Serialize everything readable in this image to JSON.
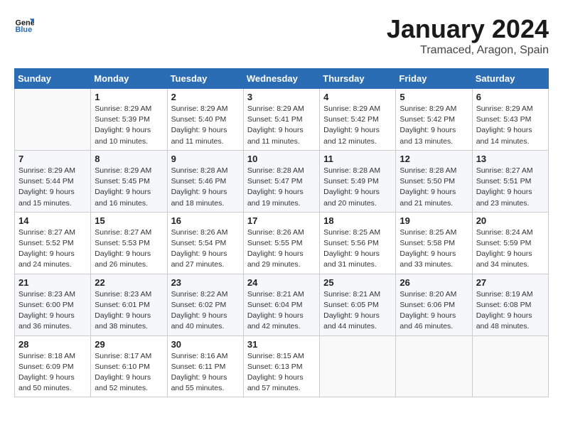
{
  "header": {
    "logo_line1": "General",
    "logo_line2": "Blue",
    "month_year": "January 2024",
    "location": "Tramaced, Aragon, Spain"
  },
  "days_of_week": [
    "Sunday",
    "Monday",
    "Tuesday",
    "Wednesday",
    "Thursday",
    "Friday",
    "Saturday"
  ],
  "weeks": [
    [
      {
        "num": "",
        "info": ""
      },
      {
        "num": "1",
        "info": "Sunrise: 8:29 AM\nSunset: 5:39 PM\nDaylight: 9 hours\nand 10 minutes."
      },
      {
        "num": "2",
        "info": "Sunrise: 8:29 AM\nSunset: 5:40 PM\nDaylight: 9 hours\nand 11 minutes."
      },
      {
        "num": "3",
        "info": "Sunrise: 8:29 AM\nSunset: 5:41 PM\nDaylight: 9 hours\nand 11 minutes."
      },
      {
        "num": "4",
        "info": "Sunrise: 8:29 AM\nSunset: 5:42 PM\nDaylight: 9 hours\nand 12 minutes."
      },
      {
        "num": "5",
        "info": "Sunrise: 8:29 AM\nSunset: 5:42 PM\nDaylight: 9 hours\nand 13 minutes."
      },
      {
        "num": "6",
        "info": "Sunrise: 8:29 AM\nSunset: 5:43 PM\nDaylight: 9 hours\nand 14 minutes."
      }
    ],
    [
      {
        "num": "7",
        "info": "Sunrise: 8:29 AM\nSunset: 5:44 PM\nDaylight: 9 hours\nand 15 minutes."
      },
      {
        "num": "8",
        "info": "Sunrise: 8:29 AM\nSunset: 5:45 PM\nDaylight: 9 hours\nand 16 minutes."
      },
      {
        "num": "9",
        "info": "Sunrise: 8:28 AM\nSunset: 5:46 PM\nDaylight: 9 hours\nand 18 minutes."
      },
      {
        "num": "10",
        "info": "Sunrise: 8:28 AM\nSunset: 5:47 PM\nDaylight: 9 hours\nand 19 minutes."
      },
      {
        "num": "11",
        "info": "Sunrise: 8:28 AM\nSunset: 5:49 PM\nDaylight: 9 hours\nand 20 minutes."
      },
      {
        "num": "12",
        "info": "Sunrise: 8:28 AM\nSunset: 5:50 PM\nDaylight: 9 hours\nand 21 minutes."
      },
      {
        "num": "13",
        "info": "Sunrise: 8:27 AM\nSunset: 5:51 PM\nDaylight: 9 hours\nand 23 minutes."
      }
    ],
    [
      {
        "num": "14",
        "info": "Sunrise: 8:27 AM\nSunset: 5:52 PM\nDaylight: 9 hours\nand 24 minutes."
      },
      {
        "num": "15",
        "info": "Sunrise: 8:27 AM\nSunset: 5:53 PM\nDaylight: 9 hours\nand 26 minutes."
      },
      {
        "num": "16",
        "info": "Sunrise: 8:26 AM\nSunset: 5:54 PM\nDaylight: 9 hours\nand 27 minutes."
      },
      {
        "num": "17",
        "info": "Sunrise: 8:26 AM\nSunset: 5:55 PM\nDaylight: 9 hours\nand 29 minutes."
      },
      {
        "num": "18",
        "info": "Sunrise: 8:25 AM\nSunset: 5:56 PM\nDaylight: 9 hours\nand 31 minutes."
      },
      {
        "num": "19",
        "info": "Sunrise: 8:25 AM\nSunset: 5:58 PM\nDaylight: 9 hours\nand 33 minutes."
      },
      {
        "num": "20",
        "info": "Sunrise: 8:24 AM\nSunset: 5:59 PM\nDaylight: 9 hours\nand 34 minutes."
      }
    ],
    [
      {
        "num": "21",
        "info": "Sunrise: 8:23 AM\nSunset: 6:00 PM\nDaylight: 9 hours\nand 36 minutes."
      },
      {
        "num": "22",
        "info": "Sunrise: 8:23 AM\nSunset: 6:01 PM\nDaylight: 9 hours\nand 38 minutes."
      },
      {
        "num": "23",
        "info": "Sunrise: 8:22 AM\nSunset: 6:02 PM\nDaylight: 9 hours\nand 40 minutes."
      },
      {
        "num": "24",
        "info": "Sunrise: 8:21 AM\nSunset: 6:04 PM\nDaylight: 9 hours\nand 42 minutes."
      },
      {
        "num": "25",
        "info": "Sunrise: 8:21 AM\nSunset: 6:05 PM\nDaylight: 9 hours\nand 44 minutes."
      },
      {
        "num": "26",
        "info": "Sunrise: 8:20 AM\nSunset: 6:06 PM\nDaylight: 9 hours\nand 46 minutes."
      },
      {
        "num": "27",
        "info": "Sunrise: 8:19 AM\nSunset: 6:08 PM\nDaylight: 9 hours\nand 48 minutes."
      }
    ],
    [
      {
        "num": "28",
        "info": "Sunrise: 8:18 AM\nSunset: 6:09 PM\nDaylight: 9 hours\nand 50 minutes."
      },
      {
        "num": "29",
        "info": "Sunrise: 8:17 AM\nSunset: 6:10 PM\nDaylight: 9 hours\nand 52 minutes."
      },
      {
        "num": "30",
        "info": "Sunrise: 8:16 AM\nSunset: 6:11 PM\nDaylight: 9 hours\nand 55 minutes."
      },
      {
        "num": "31",
        "info": "Sunrise: 8:15 AM\nSunset: 6:13 PM\nDaylight: 9 hours\nand 57 minutes."
      },
      {
        "num": "",
        "info": ""
      },
      {
        "num": "",
        "info": ""
      },
      {
        "num": "",
        "info": ""
      }
    ]
  ]
}
